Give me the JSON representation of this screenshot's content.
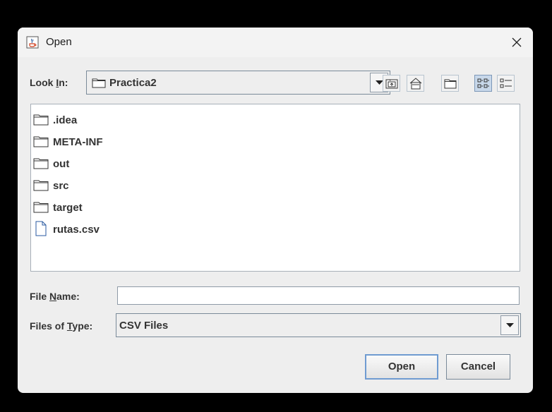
{
  "window": {
    "title": "Open",
    "icon": "java-cup-icon",
    "close_icon": "close-icon"
  },
  "look_in": {
    "label_prefix": "Look ",
    "label_mnemonic": "I",
    "label_suffix": "n:",
    "selected": "Practica2",
    "icon": "folder-icon"
  },
  "toolbar": {
    "buttons": [
      {
        "name": "up-one-level",
        "icon": "folder-up-icon"
      },
      {
        "name": "home",
        "icon": "home-icon"
      },
      {
        "name": "create-new-folder",
        "icon": "new-folder-icon"
      },
      {
        "name": "list-view",
        "icon": "list-view-icon",
        "selected": true
      },
      {
        "name": "details-view",
        "icon": "details-view-icon",
        "selected": false
      }
    ]
  },
  "files": [
    {
      "name": ".idea",
      "type": "folder"
    },
    {
      "name": "META-INF",
      "type": "folder"
    },
    {
      "name": "out",
      "type": "folder"
    },
    {
      "name": "src",
      "type": "folder"
    },
    {
      "name": "target",
      "type": "folder"
    },
    {
      "name": "rutas.csv",
      "type": "file"
    }
  ],
  "file_name": {
    "label_prefix": "File ",
    "label_mnemonic": "N",
    "label_suffix": "ame:",
    "value": ""
  },
  "file_type": {
    "label_prefix": "Files of ",
    "label_mnemonic": "T",
    "label_suffix": "ype:",
    "selected": "CSV Files"
  },
  "buttons": {
    "open": "Open",
    "cancel": "Cancel"
  },
  "colors": {
    "background": "#000000",
    "dialog": "#eeeeee",
    "selected_toggle": "#c8d8ea",
    "focus_border": "#6f9bd1"
  }
}
